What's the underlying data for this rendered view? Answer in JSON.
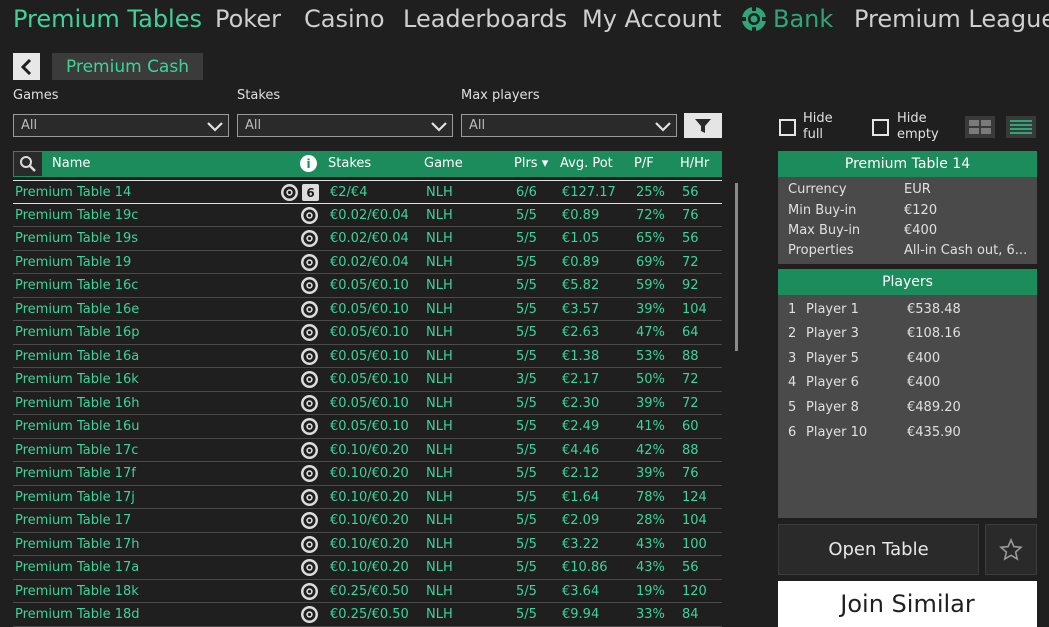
{
  "nav": {
    "items": [
      "Premium Tables",
      "Poker",
      "Casino",
      "Leaderboards",
      "My Account",
      "Bank",
      "Premium League"
    ]
  },
  "subheader": {
    "back_icon": "chevron-left-icon",
    "tab_label": "Premium Cash"
  },
  "filters": {
    "games_label": "Games",
    "games_value": "All",
    "stakes_label": "Stakes",
    "stakes_value": "All",
    "maxplayers_label": "Max players",
    "maxplayers_value": "All",
    "filter_icon": "funnel-icon"
  },
  "table": {
    "headers": {
      "name": "Name",
      "stakes": "Stakes",
      "game": "Game",
      "plrs": "Plrs ▾",
      "avg": "Avg. Pot",
      "pf": "P/F",
      "hhr": "H/Hr"
    },
    "rows": [
      {
        "name": "Premium Table 14",
        "stakes": "€2/€4",
        "game": "NLH",
        "plrs": "6/6",
        "avg": "€127.17",
        "pf": "25%",
        "hhr": "56",
        "seats": "6"
      },
      {
        "name": "Premium Table 19c",
        "stakes": "€0.02/€0.04",
        "game": "NLH",
        "plrs": "5/5",
        "avg": "€0.89",
        "pf": "72%",
        "hhr": "76"
      },
      {
        "name": "Premium Table 19s",
        "stakes": "€0.02/€0.04",
        "game": "NLH",
        "plrs": "5/5",
        "avg": "€1.05",
        "pf": "65%",
        "hhr": "56"
      },
      {
        "name": "Premium Table 19",
        "stakes": "€0.02/€0.04",
        "game": "NLH",
        "plrs": "5/5",
        "avg": "€0.89",
        "pf": "69%",
        "hhr": "72"
      },
      {
        "name": "Premium Table 16c",
        "stakes": "€0.05/€0.10",
        "game": "NLH",
        "plrs": "5/5",
        "avg": "€5.82",
        "pf": "59%",
        "hhr": "92"
      },
      {
        "name": "Premium Table 16e",
        "stakes": "€0.05/€0.10",
        "game": "NLH",
        "plrs": "5/5",
        "avg": "€3.57",
        "pf": "39%",
        "hhr": "104"
      },
      {
        "name": "Premium Table 16p",
        "stakes": "€0.05/€0.10",
        "game": "NLH",
        "plrs": "5/5",
        "avg": "€2.63",
        "pf": "47%",
        "hhr": "64"
      },
      {
        "name": "Premium Table 16a",
        "stakes": "€0.05/€0.10",
        "game": "NLH",
        "plrs": "5/5",
        "avg": "€1.38",
        "pf": "53%",
        "hhr": "88"
      },
      {
        "name": "Premium Table 16k",
        "stakes": "€0.05/€0.10",
        "game": "NLH",
        "plrs": "3/5",
        "avg": "€2.17",
        "pf": "50%",
        "hhr": "72"
      },
      {
        "name": "Premium Table 16h",
        "stakes": "€0.05/€0.10",
        "game": "NLH",
        "plrs": "5/5",
        "avg": "€2.30",
        "pf": "39%",
        "hhr": "72"
      },
      {
        "name": "Premium Table 16u",
        "stakes": "€0.05/€0.10",
        "game": "NLH",
        "plrs": "5/5",
        "avg": "€2.49",
        "pf": "41%",
        "hhr": "60"
      },
      {
        "name": "Premium Table 17c",
        "stakes": "€0.10/€0.20",
        "game": "NLH",
        "plrs": "5/5",
        "avg": "€4.46",
        "pf": "42%",
        "hhr": "88"
      },
      {
        "name": "Premium Table 17f",
        "stakes": "€0.10/€0.20",
        "game": "NLH",
        "plrs": "5/5",
        "avg": "€2.12",
        "pf": "39%",
        "hhr": "76"
      },
      {
        "name": "Premium Table 17j",
        "stakes": "€0.10/€0.20",
        "game": "NLH",
        "plrs": "5/5",
        "avg": "€1.64",
        "pf": "78%",
        "hhr": "124"
      },
      {
        "name": "Premium Table 17",
        "stakes": "€0.10/€0.20",
        "game": "NLH",
        "plrs": "5/5",
        "avg": "€2.09",
        "pf": "28%",
        "hhr": "104"
      },
      {
        "name": "Premium Table 17h",
        "stakes": "€0.10/€0.20",
        "game": "NLH",
        "plrs": "5/5",
        "avg": "€3.22",
        "pf": "43%",
        "hhr": "100"
      },
      {
        "name": "Premium Table 17a",
        "stakes": "€0.10/€0.20",
        "game": "NLH",
        "plrs": "5/5",
        "avg": "€10.86",
        "pf": "43%",
        "hhr": "56"
      },
      {
        "name": "Premium Table 18k",
        "stakes": "€0.25/€0.50",
        "game": "NLH",
        "plrs": "5/5",
        "avg": "€3.64",
        "pf": "19%",
        "hhr": "120"
      },
      {
        "name": "Premium Table 18d",
        "stakes": "€0.25/€0.50",
        "game": "NLH",
        "plrs": "5/5",
        "avg": "€9.94",
        "pf": "33%",
        "hhr": "84"
      }
    ]
  },
  "options": {
    "hide_full": "Hide full",
    "hide_empty": "Hide empty"
  },
  "details": {
    "title": "Premium Table 14",
    "fields": [
      {
        "label": "Currency",
        "value": "EUR"
      },
      {
        "label": "Min Buy-in",
        "value": "€120"
      },
      {
        "label": "Max Buy-in",
        "value": "€400"
      },
      {
        "label": "Properties",
        "value": "All-in Cash out, 6..."
      }
    ]
  },
  "players": {
    "title": "Players",
    "list": [
      {
        "num": "1",
        "name": "Player 1",
        "amount": "€538.48"
      },
      {
        "num": "2",
        "name": "Player 3",
        "amount": "€108.16"
      },
      {
        "num": "3",
        "name": "Player 5",
        "amount": "€400"
      },
      {
        "num": "4",
        "name": "Player 6",
        "amount": "€400"
      },
      {
        "num": "5",
        "name": "Player 8",
        "amount": "€489.20"
      },
      {
        "num": "6",
        "name": "Player 10",
        "amount": "€435.90"
      }
    ]
  },
  "actions": {
    "open_table": "Open Table",
    "join_similar": "Join Similar",
    "favorite_icon": "star-icon"
  },
  "colors": {
    "accent": "#3ed39a",
    "header_green": "#1d8c5c",
    "background": "#1f1f1f"
  }
}
